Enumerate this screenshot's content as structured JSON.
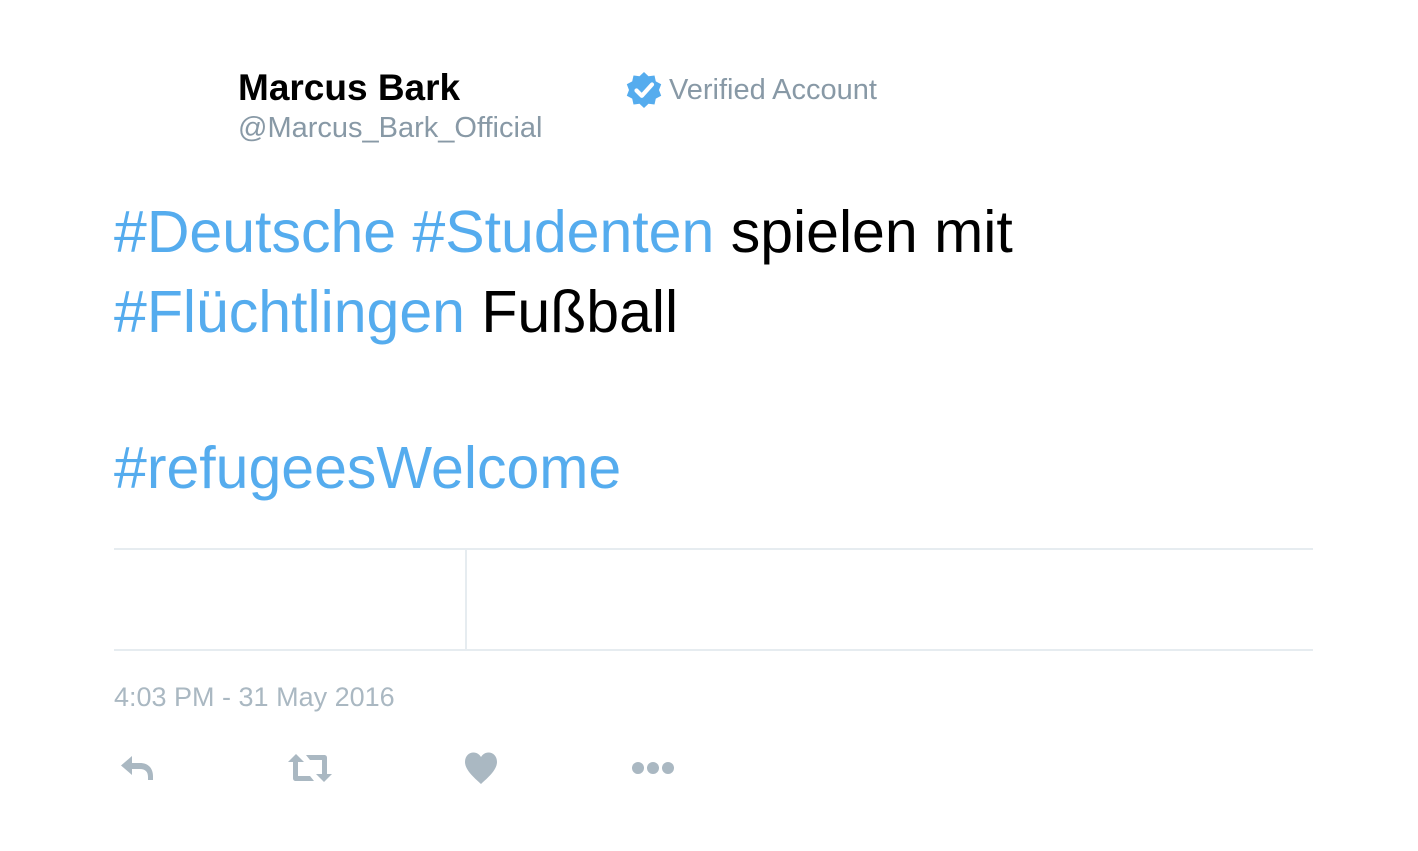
{
  "author": {
    "name": "Marcus Bark",
    "handle": "@Marcus_Bark_Official",
    "verified_label": "Verified Account"
  },
  "tweet": {
    "line1": {
      "hashtag1": "#Deutsche",
      "hashtag2": "#Studenten",
      "text": "spielen mit"
    },
    "line2": {
      "hashtag": "#Flüchtlingen",
      "text": "Fußball"
    },
    "line3": {
      "hashtag": "#refugeesWelcome"
    }
  },
  "timestamp": "4:03 PM - 31 May 2016",
  "actions": [
    {
      "name": "reply",
      "icon": "reply-icon"
    },
    {
      "name": "retweet",
      "icon": "retweet-icon"
    },
    {
      "name": "like",
      "icon": "heart-icon"
    },
    {
      "name": "more",
      "icon": "more-icon"
    }
  ],
  "colors": {
    "hashtag": "#55acee",
    "text": "#000000",
    "muted": "#8899a6",
    "timestamp": "#aab8c2",
    "icon": "#aab8c2",
    "rule": "#e6ecf0",
    "verified_badge": "#55acee"
  }
}
